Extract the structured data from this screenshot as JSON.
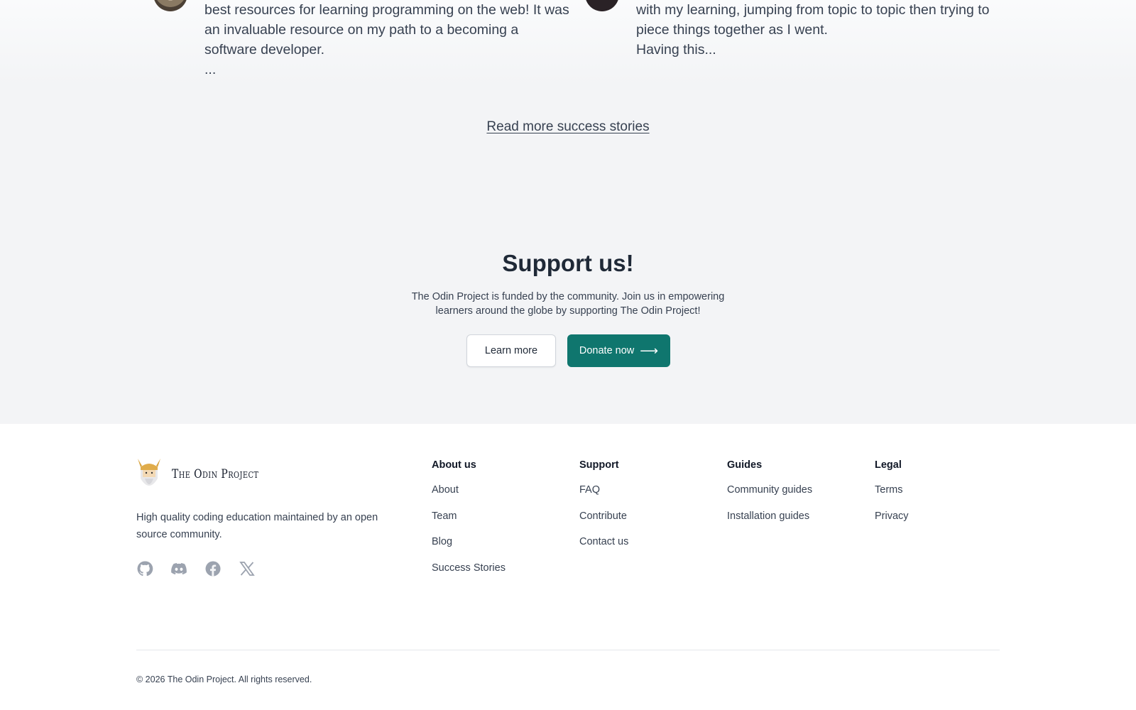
{
  "testimonials": [
    {
      "quote": "best resources for learning programming on the web! It was\nan invaluable resource on my path to a becoming a\nsoftware developer.\n..."
    },
    {
      "quote": "with my learning, jumping from topic to topic then trying to\npiece things together as I went.\nHaving this..."
    }
  ],
  "read_more_label": "Read more success stories",
  "support": {
    "title": "Support us!",
    "text": "The Odin Project is funded by the community. Join us in empowering learners around the globe by supporting The Odin Project!",
    "learn_more_label": "Learn more",
    "donate_label": "Donate now",
    "donate_arrow": "⟶",
    "donate_color": "#0f766e"
  },
  "footer": {
    "logo_text": "The Odin Project",
    "tagline": "High quality coding education maintained by an open source community.",
    "socials": [
      "github-icon",
      "discord-icon",
      "facebook-icon",
      "x-twitter-icon"
    ],
    "columns": {
      "about": {
        "title": "About us",
        "links": [
          "About",
          "Team",
          "Blog",
          "Success Stories"
        ]
      },
      "support": {
        "title": "Support",
        "links": [
          "FAQ",
          "Contribute",
          "Contact us"
        ]
      },
      "guides": {
        "title": "Guides",
        "links": [
          "Community guides",
          "Installation guides"
        ]
      },
      "legal": {
        "title": "Legal",
        "links": [
          "Terms",
          "Privacy"
        ]
      }
    },
    "copyright": "© 2026 The Odin Project. All rights reserved."
  }
}
